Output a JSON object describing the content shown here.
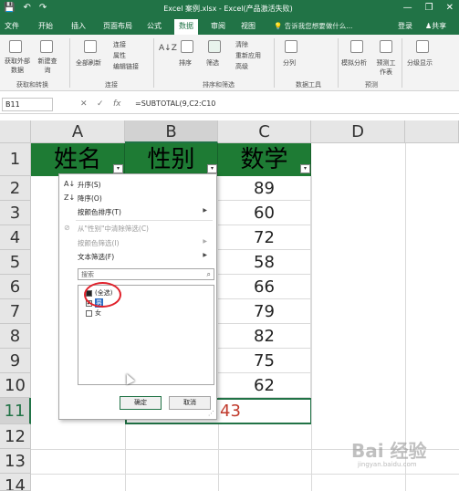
{
  "window": {
    "title": "Excel 案例.xlsx - Excel(产品激活失败)",
    "quick_access": [
      "💾",
      "↶",
      "↷"
    ],
    "controls": [
      "—",
      "❐",
      "✕"
    ]
  },
  "tabs": [
    {
      "label": "文件",
      "active": false
    },
    {
      "label": "开始",
      "active": false
    },
    {
      "label": "插入",
      "active": false
    },
    {
      "label": "页面布局",
      "active": false
    },
    {
      "label": "公式",
      "active": false
    },
    {
      "label": "数据",
      "active": true
    },
    {
      "label": "审阅",
      "active": false
    },
    {
      "label": "视图",
      "active": false
    }
  ],
  "tell_me": "告诉我您想要做什么...",
  "login": "登录",
  "share": "共享",
  "ribbon": {
    "get_data": "获取外部数据",
    "new_query": "新建查询",
    "refresh_all": "全部刷新",
    "connections": "连接",
    "properties": "属性",
    "edit_links": "编辑链接",
    "sort": "排序",
    "filter": "筛选",
    "clear": "清除",
    "reapply": "重新应用",
    "advanced": "高级",
    "split_columns": "分列",
    "what_if": "模拟分析",
    "forecast_sheet": "预测工作表",
    "outline": "分级显示",
    "group_get_transform": "获取和转换",
    "group_connections": "连接",
    "group_sort_filter": "排序和筛选",
    "group_data_tools": "数据工具",
    "group_forecast": "预测"
  },
  "formula_bar": {
    "name_box": "B11",
    "cancel": "✕",
    "enter": "✓",
    "fx": "fx",
    "formula": "=SUBTOTAL(9,C2:C10"
  },
  "sheet": {
    "columns": [
      "A",
      "B",
      "C",
      "D"
    ],
    "rows": [
      "1",
      "2",
      "3",
      "4",
      "5",
      "6",
      "7",
      "8",
      "9",
      "10",
      "11",
      "12",
      "13",
      "14"
    ],
    "headers": [
      "姓名",
      "性别",
      "数学"
    ],
    "math_values": [
      "89",
      "60",
      "72",
      "58",
      "66",
      "79",
      "82",
      "75",
      "62"
    ],
    "subtotal_partial": "43"
  },
  "filter_menu": {
    "sort_asc": "升序(S)",
    "sort_desc": "降序(O)",
    "sort_by_color": "按颜色排序(T)",
    "clear_filter": "从\"性别\"中清除筛选(C)",
    "filter_by_color": "按颜色筛选(I)",
    "text_filter": "文本筛选(F)",
    "search_placeholder": "搜索",
    "items": [
      {
        "label": "(全选)",
        "state": "partial"
      },
      {
        "label": "男",
        "state": "checked"
      },
      {
        "label": "女",
        "state": "unchecked"
      }
    ],
    "ok": "确定",
    "cancel": "取消"
  },
  "watermark": "Bai 经验",
  "watermark_sub": "jingyan.baidu.com"
}
